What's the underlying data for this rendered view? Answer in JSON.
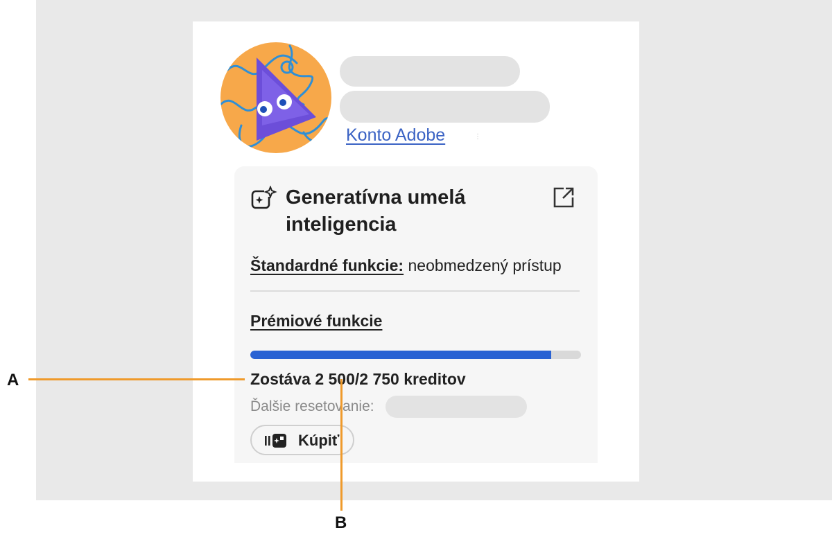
{
  "account": {
    "link_label": "Konto Adobe"
  },
  "card": {
    "title": "Generatívna umelá inteligencia",
    "standard_label": "Štandardné funkcie:",
    "standard_value": " neobmedzený prístup",
    "premium_label": "Prémiové funkcie",
    "credits_text": "Zostáva 2 500/2 750 kreditov",
    "credits_remaining": 2500,
    "credits_total": 2750,
    "progress_fraction": 0.909,
    "reset_label": "Ďalšie resetovanie:",
    "buy_label": "Kúpiť"
  },
  "callouts": {
    "a": "A",
    "b": "B"
  },
  "icons": {
    "ai": "generative-ai-sparkle-icon",
    "external": "open-external-icon",
    "buy": "credits-icon"
  },
  "colors": {
    "accent": "#2962d3",
    "link": "#3b63c4",
    "callout": "#ef9a2b",
    "avatar_bg": "#f7a84a",
    "avatar_character": "#6c4ed9"
  }
}
